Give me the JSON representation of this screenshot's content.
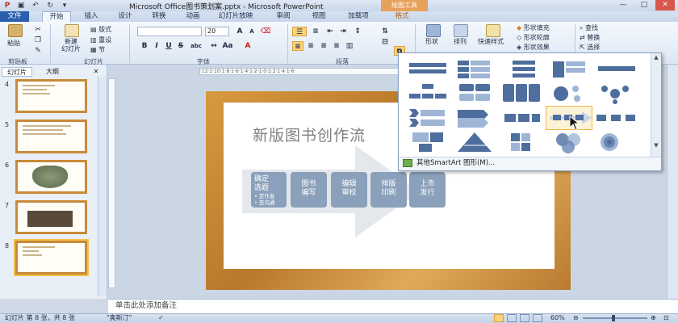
{
  "window": {
    "title": "Microsoft Office图书策划案.pptx - Microsoft PowerPoint",
    "context_tools": "绘图工具",
    "min": "—",
    "max": "□",
    "close": "✕"
  },
  "tabs": [
    {
      "label": "文件"
    },
    {
      "label": "开始"
    },
    {
      "label": "插入"
    },
    {
      "label": "设计"
    },
    {
      "label": "转换"
    },
    {
      "label": "动画"
    },
    {
      "label": "幻灯片放映"
    },
    {
      "label": "审阅"
    },
    {
      "label": "视图"
    },
    {
      "label": "加载项"
    },
    {
      "label": "格式"
    }
  ],
  "ribbon": {
    "clipboard": {
      "paste": "粘贴",
      "group": "剪贴板"
    },
    "slides": {
      "new_slide": "新建\n幻灯片",
      "layout": "版式",
      "reset": "重设",
      "section": "节",
      "group": "幻灯片"
    },
    "font": {
      "font_name": "",
      "font_size": "20",
      "bold": "B",
      "italic": "I",
      "underline": "U",
      "strike": "S",
      "shadow": "abc",
      "group": "字体"
    },
    "paragraph": {
      "group": "段落"
    },
    "drawing": {
      "shapes": "形状",
      "arrange": "排列",
      "quick_styles": "快速样式",
      "fill": "形状填充",
      "outline": "形状轮廓",
      "effects": "形状效果"
    },
    "editing": {
      "find": "查找",
      "replace": "替换",
      "select": "选择"
    }
  },
  "left_pane": {
    "tabs": [
      "幻灯片",
      "大纲"
    ],
    "close": "✕",
    "slides": [
      {
        "number": "4"
      },
      {
        "number": "5"
      },
      {
        "number": "6"
      },
      {
        "number": "7"
      },
      {
        "number": "8"
      }
    ]
  },
  "slide": {
    "title": "新版图书创作流",
    "steps": [
      {
        "label": "确定\n选题",
        "bullets": [
          "• 定作者",
          "• 签沟通"
        ]
      },
      {
        "label": "图书\n编写"
      },
      {
        "label": "编辑\n审校"
      },
      {
        "label": "排版\n印刷"
      },
      {
        "label": "上市\n发行"
      }
    ]
  },
  "gallery": {
    "more": "其他SmartArt 图形(M)..."
  },
  "notes": {
    "placeholder": "单击此处添加备注"
  },
  "status": {
    "slide_info": "幻灯片 第 8 张，共 8 张",
    "theme": "\"奥斯汀\"",
    "zoom": "60%"
  },
  "colors": {
    "file_tab": "#2a5fb0",
    "context_tab": "#e8a15a",
    "smartart_box": "#8ba0ba",
    "slide_frame": "#d89a3f"
  }
}
